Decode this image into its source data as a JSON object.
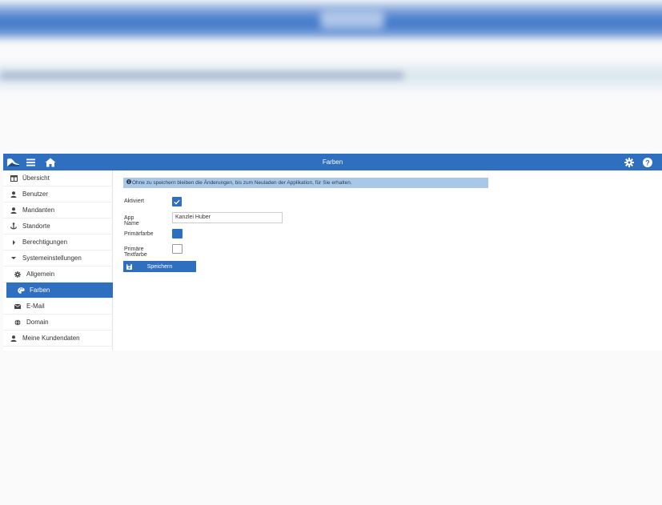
{
  "header": {
    "title": "Farben"
  },
  "topbar_icons": {
    "logo": "app-logo-icon",
    "menu": "hamburger-menu-icon",
    "home": "home-icon",
    "settings": "gear-icon",
    "help": "help-icon"
  },
  "sidebar": {
    "items": [
      {
        "label": "Übersicht",
        "icon": "dashboard-icon"
      },
      {
        "label": "Benutzer",
        "icon": "user-icon"
      },
      {
        "label": "Mandanten",
        "icon": "client-icon"
      },
      {
        "label": "Standorte",
        "icon": "location-icon"
      },
      {
        "label": "Berechtigungen",
        "icon": "caret-right-icon"
      },
      {
        "label": "Systemeinstellungen",
        "icon": "caret-down-icon"
      },
      {
        "label": "Allgemein",
        "icon": "gear-icon"
      },
      {
        "label": "Farben",
        "icon": "palette-icon",
        "active": true
      },
      {
        "label": "E-Mail",
        "icon": "envelope-icon"
      },
      {
        "label": "Domain",
        "icon": "globe-icon"
      },
      {
        "label": "Meine Kundendaten",
        "icon": "user-icon"
      }
    ]
  },
  "main": {
    "info": "Ohne zu speichern bleiben die Änderungen, bis zum Neuladen der Applikation, für Sie erhalten.",
    "labels": {
      "activated": "Aktiviert",
      "app_name": "App Name",
      "primary_color": "Primärfarbe",
      "primary_text_color": "Primäre Textfarbe"
    },
    "app_name_value": "Kanzlei Huber",
    "activated_checked": true,
    "primary_color": "#2f6fc0",
    "primary_text_color": "#ffffff",
    "save_label": "Speichern"
  }
}
